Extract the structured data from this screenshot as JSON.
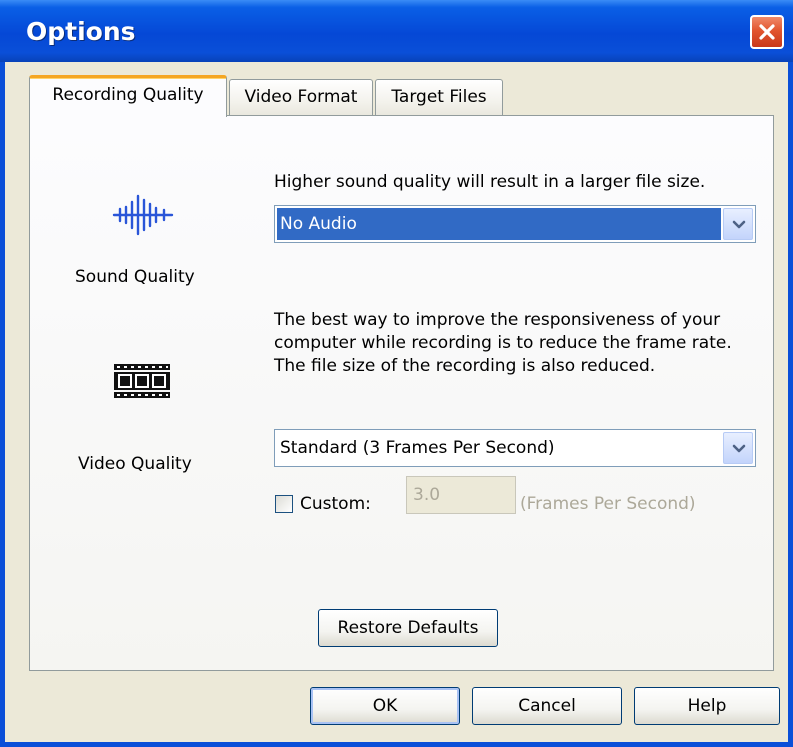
{
  "window": {
    "title": "Options"
  },
  "tabs": [
    {
      "label": "Recording Quality",
      "active": true
    },
    {
      "label": "Video Format",
      "active": false
    },
    {
      "label": "Target Files",
      "active": false
    }
  ],
  "sound": {
    "icon": "sound-wave-icon",
    "label": "Sound Quality",
    "description": "Higher sound quality will result in a larger file size.",
    "selected_value": "No Audio"
  },
  "video": {
    "icon": "film-strip-icon",
    "label": "Video Quality",
    "description": "The best way to improve the responsiveness of your computer while recording is to reduce the frame rate.  The file size of the recording is also reduced.",
    "selected_value": "Standard (3 Frames Per Second)",
    "custom_label": "Custom:",
    "custom_checked": false,
    "custom_value": "3.0",
    "custom_unit": "(Frames Per Second)"
  },
  "buttons": {
    "restore_defaults": "Restore Defaults",
    "ok": "OK",
    "cancel": "Cancel",
    "help": "Help"
  },
  "colors": {
    "titlebar": "#0a4fd8",
    "selection": "#316ac5",
    "close": "#e2552f"
  }
}
